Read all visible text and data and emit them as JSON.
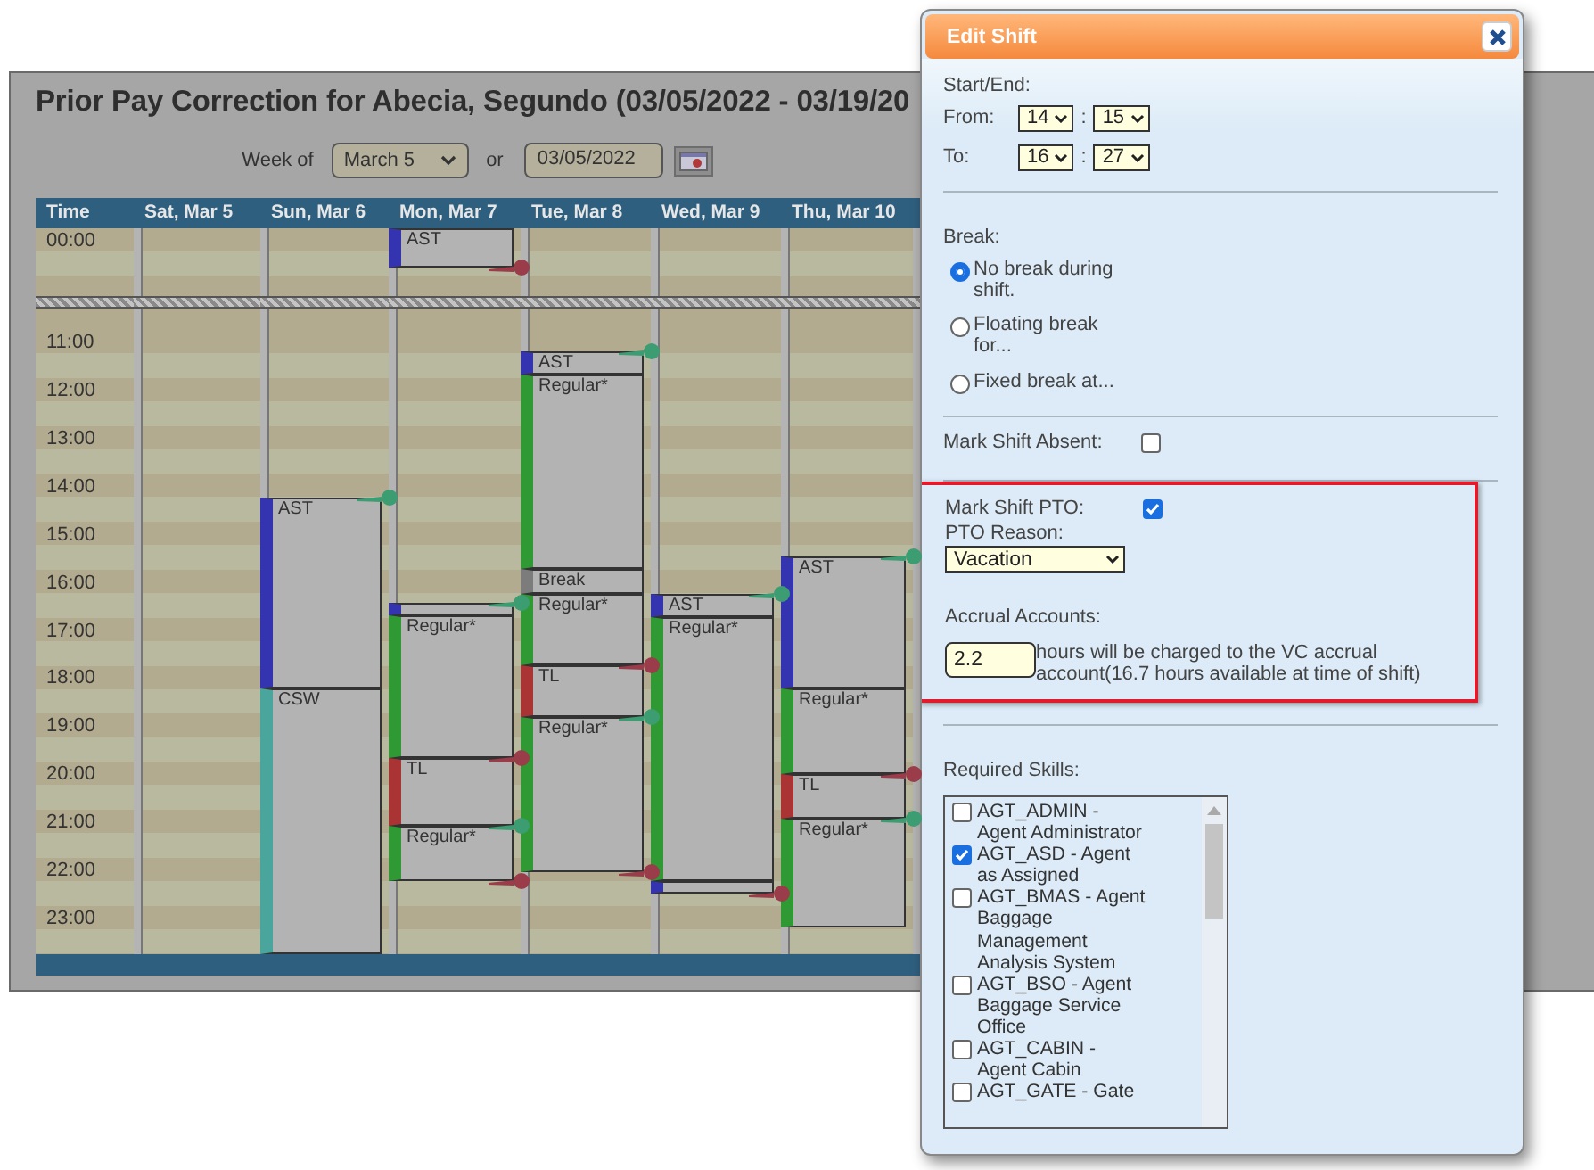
{
  "page": {
    "title": "Prior Pay Correction for Abecia, Segundo (03/05/2022 - 03/19/20"
  },
  "week_picker": {
    "label": "Week of",
    "week": "March 5",
    "separator": "or",
    "date": "03/05/2022"
  },
  "calendar": {
    "time_header": "Time",
    "hours": [
      "00:00",
      "11:00",
      "12:00",
      "13:00",
      "14:00",
      "15:00",
      "16:00",
      "17:00",
      "18:00",
      "19:00",
      "20:00",
      "21:00",
      "22:00",
      "23:00"
    ],
    "days": [
      {
        "header": "Sat, Mar 5"
      },
      {
        "header": "Sun, Mar 6",
        "shifts": [
          {
            "kind": "ast",
            "label": "AST",
            "start_marker": true,
            "end_marker": false
          },
          {
            "kind": "csw",
            "label": "CSW",
            "start_marker": false,
            "end_marker": false
          }
        ]
      },
      {
        "header": "Mon, Mar 7",
        "shifts": [
          {
            "kind": "ast",
            "label": "AST",
            "start_marker": false,
            "end_marker": true
          },
          {
            "kind": "ast",
            "start_marker": true,
            "end_marker": false
          },
          {
            "kind": "regular",
            "label": "Regular*",
            "start_marker": false,
            "end_marker": true
          },
          {
            "kind": "tl",
            "label": "TL",
            "start_marker": false,
            "end_marker": false
          },
          {
            "kind": "regular",
            "label": "Regular*",
            "start_marker": true,
            "end_marker": true
          }
        ]
      },
      {
        "header": "Tue, Mar 8",
        "shifts": [
          {
            "kind": "ast",
            "label": "AST",
            "start_marker": true,
            "end_marker": false
          },
          {
            "kind": "regular",
            "label": "Regular*",
            "start_marker": false,
            "end_marker": false
          },
          {
            "kind": "break",
            "label": "Break",
            "start_marker": false,
            "end_marker": false
          },
          {
            "kind": "regular",
            "label": "Regular*",
            "start_marker": false,
            "end_marker": true
          },
          {
            "kind": "tl",
            "label": "TL",
            "start_marker": false,
            "end_marker": false
          },
          {
            "kind": "regular",
            "label": "Regular*",
            "start_marker": true,
            "end_marker": true
          }
        ]
      },
      {
        "header": "Wed, Mar 9",
        "shifts": [
          {
            "kind": "ast",
            "label": "AST",
            "start_marker": true,
            "end_marker": false
          },
          {
            "kind": "regular",
            "label": "Regular*",
            "start_marker": false,
            "end_marker": false
          },
          {
            "kind": "ast",
            "start_marker": false,
            "end_marker": true
          }
        ]
      },
      {
        "header": "Thu, Mar 10",
        "shifts": [
          {
            "kind": "ast",
            "label": "AST",
            "start_marker": true,
            "end_marker": false
          },
          {
            "kind": "regular",
            "label": "Regular*",
            "start_marker": false,
            "end_marker": true
          },
          {
            "kind": "tl",
            "label": "TL",
            "start_marker": false,
            "end_marker": false
          },
          {
            "kind": "regular",
            "label": "Regular*",
            "start_marker": true,
            "end_marker": false
          }
        ]
      }
    ]
  },
  "edit_shift": {
    "title": "Edit Shift",
    "start_end_label": "Start/End:",
    "from": {
      "label": "From:",
      "hour": "14",
      "separator": ":",
      "minute": "15"
    },
    "to": {
      "label": "To:",
      "hour": "16",
      "separator": ":",
      "minute": "27"
    },
    "break": {
      "label": "Break:",
      "options": [
        {
          "label": "No break during shift.",
          "selected": true
        },
        {
          "label": "Floating break for...",
          "selected": false
        },
        {
          "label": "Fixed break at...",
          "selected": false
        }
      ]
    },
    "absent": {
      "label": "Mark Shift Absent:",
      "checked": false
    },
    "pto": {
      "highlighted": true,
      "label": "Mark Shift PTO:",
      "checked": true,
      "reason_label": "PTO Reason:",
      "reason": "Vacation",
      "accrual_label": "Accrual Accounts:",
      "hours": "2.2",
      "accrual_text": "hours will be charged to the VC accrual account(16.7 hours available at time of shift)"
    },
    "skills": {
      "label": "Required Skills:",
      "items": [
        {
          "label": "AGT_ADMIN - Agent Administrator",
          "checked": false
        },
        {
          "label": "AGT_ASD - Agent as Assigned",
          "checked": true
        },
        {
          "label": "AGT_BMAS - Agent Baggage Management Analysis System",
          "checked": false
        },
        {
          "label": "AGT_BSO - Agent Baggage Service Office",
          "checked": false
        },
        {
          "label": "AGT_CABIN - Agent Cabin",
          "checked": false
        },
        {
          "label": "AGT_GATE - Gate",
          "checked": false
        }
      ]
    }
  }
}
